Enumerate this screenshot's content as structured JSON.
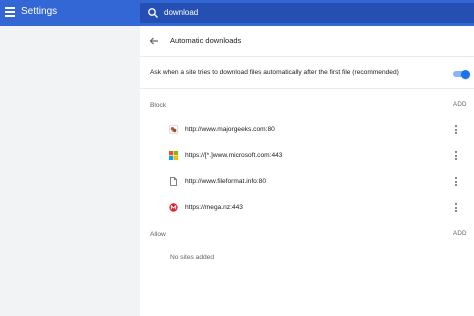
{
  "app": {
    "title": "Settings"
  },
  "search": {
    "value": "download"
  },
  "page": {
    "title": "Automatic downloads"
  },
  "ask_setting": {
    "label": "Ask when a site tries to download files automatically after the first file (recommended)",
    "enabled": true
  },
  "block": {
    "label": "Block",
    "add_label": "ADD",
    "sites": [
      {
        "url": "http://www.majorgeeks.com:80",
        "icon": "majorgeeks-favicon"
      },
      {
        "url": "https://[*.]www.microsoft.com:443",
        "icon": "microsoft-favicon"
      },
      {
        "url": "http://www.fileformat.info:80",
        "icon": "document-icon"
      },
      {
        "url": "https://mega.nz:443",
        "icon": "mega-favicon"
      }
    ]
  },
  "allow": {
    "label": "Allow",
    "add_label": "ADD",
    "empty_text": "No sites added"
  },
  "colors": {
    "topbar": "#3367d6",
    "searchbar": "#254fb3",
    "accent": "#1a73e8"
  }
}
